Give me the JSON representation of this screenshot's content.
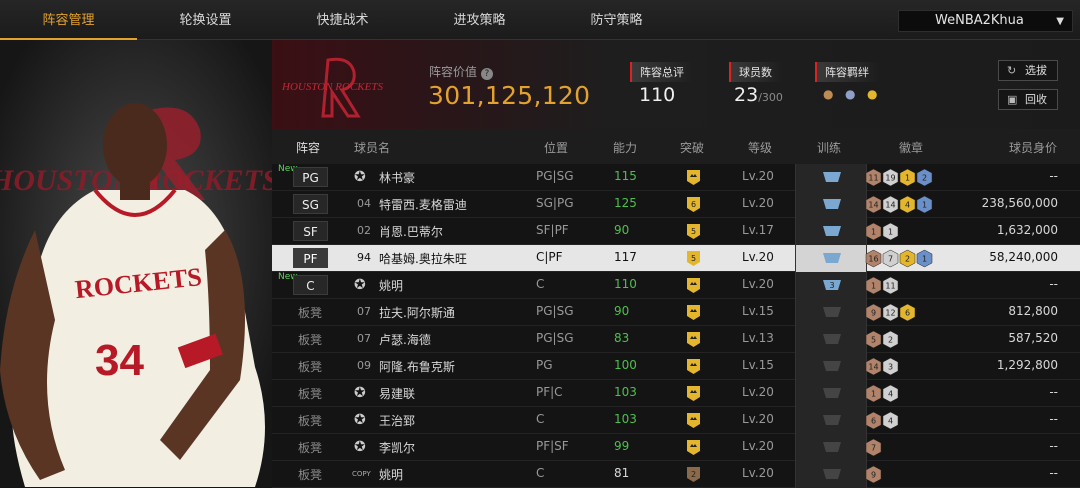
{
  "nav": {
    "tabs": [
      "阵容管理",
      "轮换设置",
      "快捷战术",
      "进攻策略",
      "防守策略"
    ],
    "account": "WeNBA2Khua"
  },
  "player_art": {
    "jersey_team": "ROCKETS",
    "jersey_number": "34",
    "bg_text": "HOUSTON ROCKETS"
  },
  "team": {
    "logo_text": "HOUSTON ROCKETS"
  },
  "summary": {
    "lineup_value_label": "阵容价值",
    "lineup_value": "301,125,120",
    "rating_label": "阵容总评",
    "rating": "110",
    "players_label": "球员数",
    "players_count": "23",
    "players_max": "/300",
    "bonds_label": "阵容羁绊",
    "select_button": "选拔",
    "recycle_button": "回收"
  },
  "columns": [
    "阵容",
    "球员名",
    "位置",
    "能力",
    "突破",
    "等级",
    "训练",
    "徽章",
    "球员身价"
  ],
  "rows": [
    {
      "slot": "PG",
      "new": "New",
      "num": "",
      "name": "林书豪",
      "pos": "PG|SG",
      "ability": "115",
      "break": "",
      "level": "Lv.20",
      "train": "",
      "badges": [
        "11",
        "19",
        "1",
        "2"
      ],
      "value": "--"
    },
    {
      "slot": "SG",
      "new": "",
      "num": "04",
      "name": "特雷西.麦格雷迪",
      "pos": "SG|PG",
      "ability": "125",
      "break": "6",
      "level": "Lv.20",
      "train": "",
      "badges": [
        "14",
        "14",
        "4",
        "1"
      ],
      "value": "238,560,000"
    },
    {
      "slot": "SF",
      "new": "",
      "num": "02",
      "name": "肖恩.巴蒂尔",
      "pos": "SF|PF",
      "ability": "90",
      "break": "5",
      "level": "Lv.17",
      "train": "",
      "badges": [
        "1",
        "1"
      ],
      "value": "1,632,000"
    },
    {
      "slot": "PF",
      "new": "",
      "num": "94",
      "name": "哈基姆.奥拉朱旺",
      "pos": "C|PF",
      "ability": "117",
      "break": "5",
      "level": "Lv.20",
      "train": "",
      "badges": [
        "16",
        "7",
        "2",
        "1"
      ],
      "value": "58,240,000"
    },
    {
      "slot": "C",
      "new": "New",
      "num": "",
      "name": "姚明",
      "pos": "C",
      "ability": "110",
      "break": "",
      "level": "Lv.20",
      "train": "3",
      "badges": [
        "1",
        "11"
      ],
      "value": "--"
    },
    {
      "slot": "板凳",
      "new": "",
      "num": "07",
      "name": "拉夫.阿尔斯通",
      "pos": "PG|SG",
      "ability": "90",
      "break": "",
      "level": "Lv.15",
      "train": "",
      "badges": [
        "9",
        "12",
        "6"
      ],
      "value": "812,800"
    },
    {
      "slot": "板凳",
      "new": "",
      "num": "07",
      "name": "卢瑟.海德",
      "pos": "PG|SG",
      "ability": "83",
      "break": "",
      "level": "Lv.13",
      "train": "",
      "badges": [
        "5",
        "2"
      ],
      "value": "587,520"
    },
    {
      "slot": "板凳",
      "new": "",
      "num": "09",
      "name": "阿隆.布鲁克斯",
      "pos": "PG",
      "ability": "100",
      "break": "",
      "level": "Lv.15",
      "train": "",
      "badges": [
        "14",
        "3"
      ],
      "value": "1,292,800"
    },
    {
      "slot": "板凳",
      "new": "",
      "num": "",
      "name": "易建联",
      "pos": "PF|C",
      "ability": "103",
      "break": "",
      "level": "Lv.20",
      "train": "",
      "badges": [
        "1",
        "4"
      ],
      "value": "--"
    },
    {
      "slot": "板凳",
      "new": "",
      "num": "",
      "name": "王治郅",
      "pos": "C",
      "ability": "103",
      "break": "",
      "level": "Lv.20",
      "train": "",
      "badges": [
        "6",
        "4"
      ],
      "value": "--"
    },
    {
      "slot": "板凳",
      "new": "",
      "num": "",
      "name": "李凯尔",
      "pos": "PF|SF",
      "ability": "99",
      "break": "",
      "level": "Lv.20",
      "train": "",
      "badges": [
        "7"
      ],
      "value": "--"
    },
    {
      "slot": "板凳",
      "new": "",
      "num": "COPY",
      "name": "姚明",
      "pos": "C",
      "ability": "81",
      "break": "2",
      "level": "Lv.20",
      "train": "",
      "badges": [
        "9"
      ],
      "value": "--"
    }
  ],
  "colors": {
    "accent": "#e3a22e",
    "green": "#4fbf4f",
    "red_tag": "#dd2222",
    "selected_row": "#e6e6e6"
  }
}
